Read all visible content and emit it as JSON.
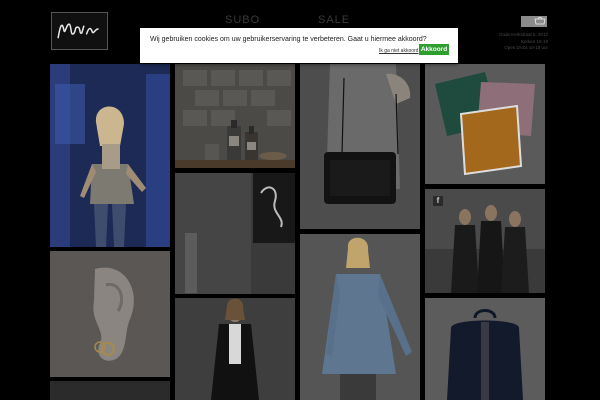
{
  "header": {
    "logo_alt": "Noir",
    "nav": [
      "SUBO",
      "SALE"
    ],
    "cart_icon": "shopping-bag-icon",
    "store_info": [
      "Oude Kerkstraat 5, 2012",
      "Kerken 15-19",
      "Open Di-Za 10-18 uur"
    ]
  },
  "cookie_banner": {
    "message": "Wij gebruiken cookies om uw gebruikerservaring te verbeteren. Gaat u hiermee akkoord?",
    "reject_label": "Ik ga niet akkoord",
    "accept_label": "Akkoord",
    "accept_color": "#2e9f2e"
  },
  "social": {
    "facebook_icon": "f"
  },
  "colors": {
    "background": "#000000",
    "accent": "#2e9f2e"
  }
}
